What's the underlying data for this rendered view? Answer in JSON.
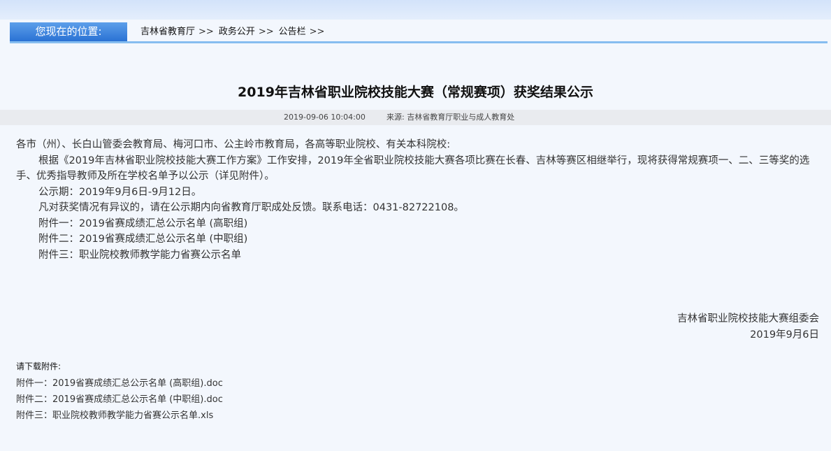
{
  "breadcrumb": {
    "label": "您现在的位置:",
    "items": [
      "吉林省教育厅",
      "政务公开",
      "公告栏"
    ],
    "separator": ">>"
  },
  "article": {
    "title": "2019年吉林省职业院校技能大赛（常规赛项）获奖结果公示",
    "date": "2019-09-06 10:04:00",
    "source": "来源:  吉林省教育厅职业与成人教育处",
    "body": {
      "salutation": "各市（州）、长白山管委会教育局、梅河口市、公主岭市教育局，各高等职业院校、有关本科院校:",
      "para1": "根据《2019年吉林省职业院校技能大赛工作方案》工作安排，2019年全省职业院校技能大赛各项比赛在长春、吉林等赛区相继举行，现将获得常规赛项一、二、三等奖的选手、优秀指导教师及所在学校名单予以公示（详见附件）。",
      "period": "公示期：2019年9月6日-9月12日。",
      "contact": "凡对获奖情况有异议的，请在公示期内向省教育厅职成处反馈。联系电话：0431-82722108。",
      "annex1": "附件一：2019省赛成绩汇总公示名单 (高职组)",
      "annex2": "附件二：2019省赛成绩汇总公示名单 (中职组)",
      "annex3": "附件三：职业院校教师教学能力省赛公示名单"
    },
    "signature": {
      "org": "吉林省职业院校技能大赛组委会",
      "date": "2019年9月6日"
    }
  },
  "downloads": {
    "title": "请下载附件:",
    "files": [
      "附件一：2019省赛成绩汇总公示名单 (高职组).doc",
      "附件二：2019省赛成绩汇总公示名单 (中职组).doc",
      "附件三：职业院校教师教学能力省赛公示名单.xls"
    ]
  }
}
